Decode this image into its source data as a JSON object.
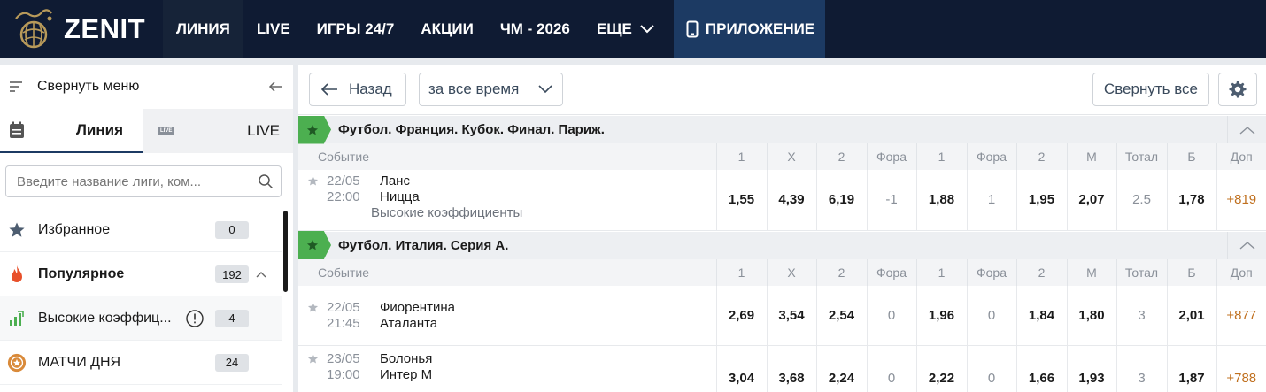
{
  "header": {
    "logo_text": "ZENIT",
    "nav": [
      {
        "label": "ЛИНИЯ",
        "active": true
      },
      {
        "label": "LIVE"
      },
      {
        "label": "ИГРЫ 24/7"
      },
      {
        "label": "АКЦИИ"
      },
      {
        "label": "ЧМ - 2026"
      },
      {
        "label": "ЕЩЕ"
      }
    ],
    "app_label": "ПРИЛОЖЕНИЕ"
  },
  "sidebar": {
    "collapse_label": "Свернуть меню",
    "tab_line": "Линия",
    "tab_live": "LIVE",
    "tab_live_badge": "LIVE",
    "search_placeholder": "Введите название лиги, ком...",
    "items": [
      {
        "label": "Избранное",
        "count": "0",
        "icon": "star-icon"
      },
      {
        "label": "Популярное",
        "count": "192",
        "icon": "fire-icon"
      },
      {
        "label": "Высокие коэффиц...",
        "count": "4",
        "icon": "bar-chart-icon"
      },
      {
        "label": "МАТЧИ ДНЯ",
        "count": "24",
        "icon": "medal-icon"
      }
    ]
  },
  "toolbar": {
    "back_label": "Назад",
    "period_value": "за все время",
    "collapse_all_label": "Свернуть все"
  },
  "columns": [
    "Событие",
    "1",
    "X",
    "2",
    "Фора",
    "1",
    "Фора",
    "2",
    "М",
    "Тотал",
    "Б",
    "Доп"
  ],
  "sections": [
    {
      "title": "Футбол. Франция. Кубок. Финал. Париж.",
      "events": [
        {
          "date": "22/05",
          "time": "22:00",
          "team1": "Ланс",
          "team2": "Ницца",
          "note": "Высокие коэффициенты",
          "odds": [
            "1,55",
            "4,39",
            "6,19",
            "-1",
            "1,88",
            "1",
            "1,95",
            "2,07",
            "2.5",
            "1,78",
            "+819"
          ]
        }
      ]
    },
    {
      "title": "Футбол. Италия. Серия А.",
      "events": [
        {
          "date": "22/05",
          "time": "21:45",
          "team1": "Фиорентина",
          "team2": "Аталанта",
          "odds": [
            "2,69",
            "3,54",
            "2,54",
            "0",
            "1,96",
            "0",
            "1,84",
            "1,80",
            "3",
            "2,01",
            "+877"
          ]
        },
        {
          "date": "23/05",
          "time": "19:00",
          "team1": "Болонья",
          "team2": "Интер М",
          "odds": [
            "3,04",
            "3,68",
            "2,24",
            "0",
            "2,22",
            "0",
            "1,66",
            "1,93",
            "3",
            "1,87",
            "+788"
          ]
        }
      ]
    }
  ],
  "colors": {
    "nav_bg": "#0f1b33",
    "app_bg": "#1c3a63",
    "green": "#4caf50",
    "plus": "#c0701f",
    "fire": "#e8502a"
  }
}
